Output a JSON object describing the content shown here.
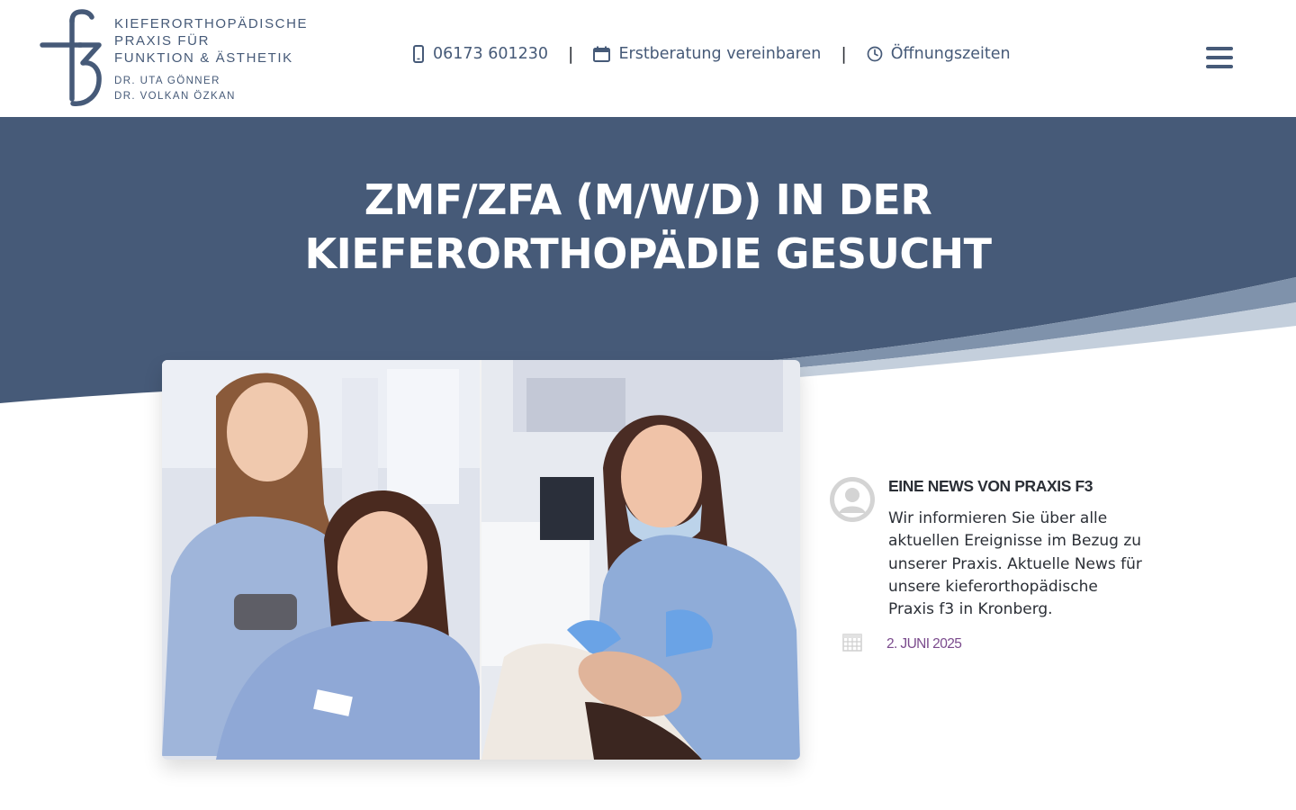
{
  "brand": {
    "logo_lines": [
      "KIEFERORTHOPÄDISCHE",
      "PRAXIS FÜR",
      "FUNKTION & ÄSTHETIK"
    ],
    "doctors": [
      "DR. UTA GÖNNER",
      "DR. VOLKAN ÖZKAN"
    ],
    "color": "#465a78"
  },
  "topnav": {
    "phone": {
      "label": "06173 601230",
      "icon": "phone-icon"
    },
    "separator": "|",
    "consult": {
      "label": "Erstberatung vereinbaren",
      "icon": "calendar-icon"
    },
    "hours": {
      "label": "Öffnungszeiten",
      "icon": "clock-icon"
    },
    "menu_icon": "hamburger-menu-icon"
  },
  "hero": {
    "title_line1": "ZMF/ZFA (M/W/D) IN DER",
    "title_line2": "KIEFERORTHOPÄDIE GESUCHT",
    "background": "#465a78"
  },
  "feature_image": {
    "description_icon": "photo"
  },
  "author_box": {
    "title": "EINE NEWS VON PRAXIS F3",
    "text": "Wir informieren Sie über alle aktuellen Ereignisse im Bezug zu unserer Praxis. Aktuelle News für unsere kieferorthopädische Praxis f3 in Kronberg.",
    "avatar_icon": "default-avatar-icon",
    "date_icon": "calendar-grid-icon",
    "date": "2. JUNI 2025",
    "date_color": "#7a4a8c"
  }
}
